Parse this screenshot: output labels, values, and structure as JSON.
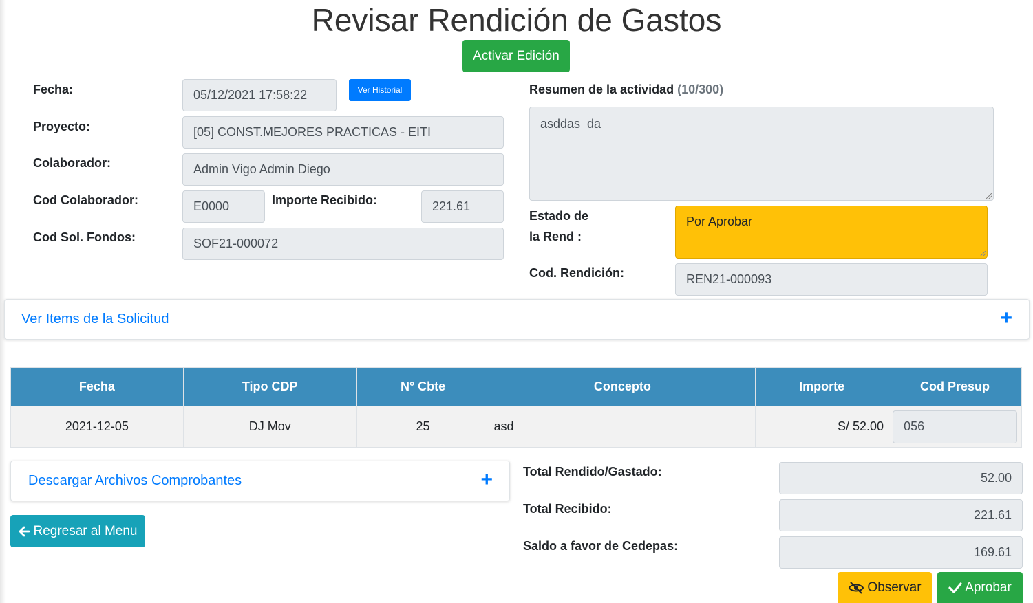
{
  "page": {
    "title": "Revisar Rendición de Gastos",
    "activate_edit_label": "Activar Edición"
  },
  "header_form": {
    "fecha_label": "Fecha:",
    "fecha_value": "05/12/2021 17:58:22",
    "historial_label": "Ver Historial",
    "proyecto_label": "Proyecto:",
    "proyecto_value": "[05] CONST.MEJORES PRACTICAS - EITI",
    "colaborador_label": "Colaborador:",
    "colaborador_value": "Admin Vigo Admin Diego",
    "cod_colaborador_label": "Cod Colaborador:",
    "cod_colaborador_value": "E0000",
    "importe_recibido_label": "Importe Recibido:",
    "importe_recibido_value": "221.61",
    "cod_sol_label": "Cod Sol. Fondos:",
    "cod_sol_value": "SOF21-000072"
  },
  "summary": {
    "resumen_label": "Resumen de la actividad",
    "resumen_count": "(10/300)",
    "resumen_value": "asddas  da",
    "estado_label_line1": "Estado de",
    "estado_label_line2": "la Rend :",
    "estado_value": "Por Aprobar",
    "cod_rendicion_label": "Cod. Rendición:",
    "cod_rendicion_value": "REN21-000093"
  },
  "items_card": {
    "label": "Ver Items de la Solicitud",
    "toggle": "+"
  },
  "table": {
    "headers": [
      "Fecha",
      "Tipo CDP",
      "N° Cbte",
      "Concepto",
      "Importe",
      "Cod Presup"
    ],
    "rows": [
      {
        "fecha": "2021-12-05",
        "tipo": "DJ Mov",
        "cbte": "25",
        "concepto": "asd",
        "importe": "S/ 52.00",
        "cod_presup": "056"
      }
    ]
  },
  "download_card": {
    "label": "Descargar Archivos Comprobantes",
    "toggle": "+"
  },
  "back_button": {
    "label": "Regresar al Menu",
    "icon": "arrow-left-icon"
  },
  "totals": {
    "rendido_label": "Total Rendido/Gastado:",
    "rendido_value": "52.00",
    "recibido_label": "Total Recibido:",
    "recibido_value": "221.61",
    "saldo_label": "Saldo a favor de Cedepas:",
    "saldo_value": "169.61"
  },
  "actions": {
    "observar_label": "Observar",
    "observar_icon": "eye-slash-icon",
    "aprobar_label": "Aprobar",
    "aprobar_icon": "check-icon"
  },
  "colors": {
    "success": "#28a745",
    "primary": "#007bff",
    "info": "#17a2b8",
    "warning": "#ffc107",
    "table_header": "#3c8dbc"
  }
}
